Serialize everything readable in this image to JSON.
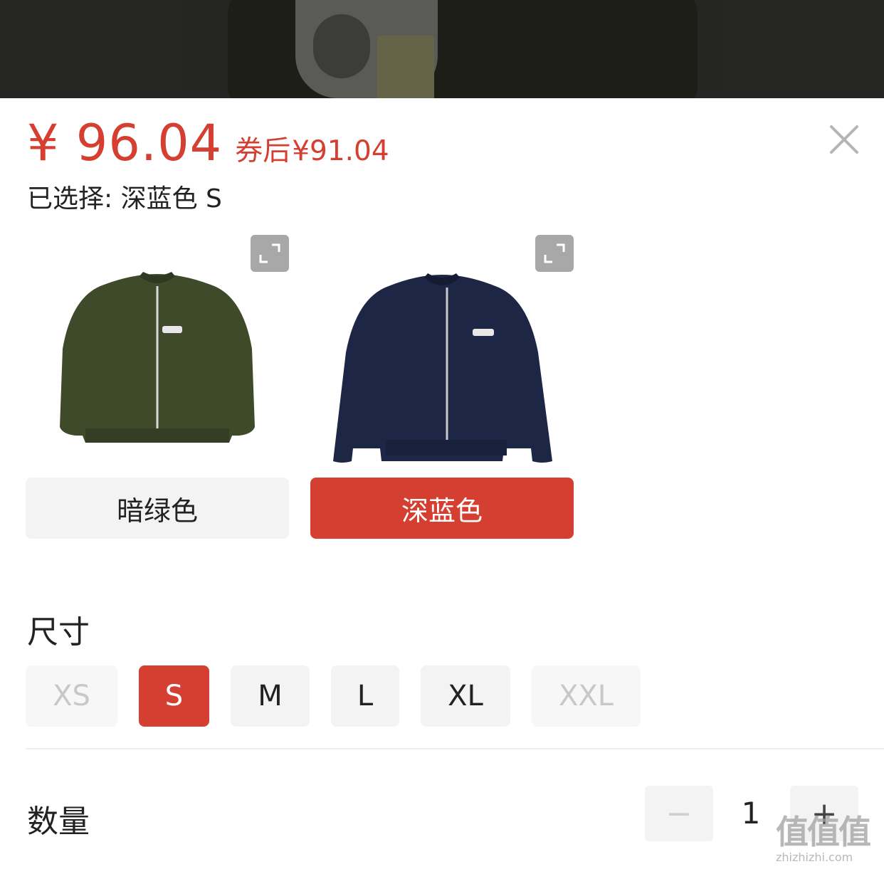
{
  "price": {
    "main": "¥ 96.04",
    "coupon_label": "券后",
    "coupon_price": "¥91.04"
  },
  "selected": {
    "text": "已选择: 深蓝色 S"
  },
  "colors": {
    "options": [
      {
        "label": "暗绿色",
        "swatch": "#3f4a2b",
        "selected": false
      },
      {
        "label": "深蓝色",
        "swatch": "#1e2645",
        "selected": true
      }
    ]
  },
  "size": {
    "title": "尺寸",
    "options": [
      {
        "label": "XS",
        "state": "disabled"
      },
      {
        "label": "S",
        "state": "selected"
      },
      {
        "label": "M",
        "state": "available"
      },
      {
        "label": "L",
        "state": "available"
      },
      {
        "label": "XL",
        "state": "available"
      },
      {
        "label": "XXL",
        "state": "disabled"
      }
    ]
  },
  "quantity": {
    "title": "数量",
    "value": "1",
    "minus": "−",
    "plus": "+"
  },
  "watermark": {
    "big": "值值值",
    "small": "zhizhizhi.com"
  },
  "theme": {
    "accent": "#d43f31"
  }
}
